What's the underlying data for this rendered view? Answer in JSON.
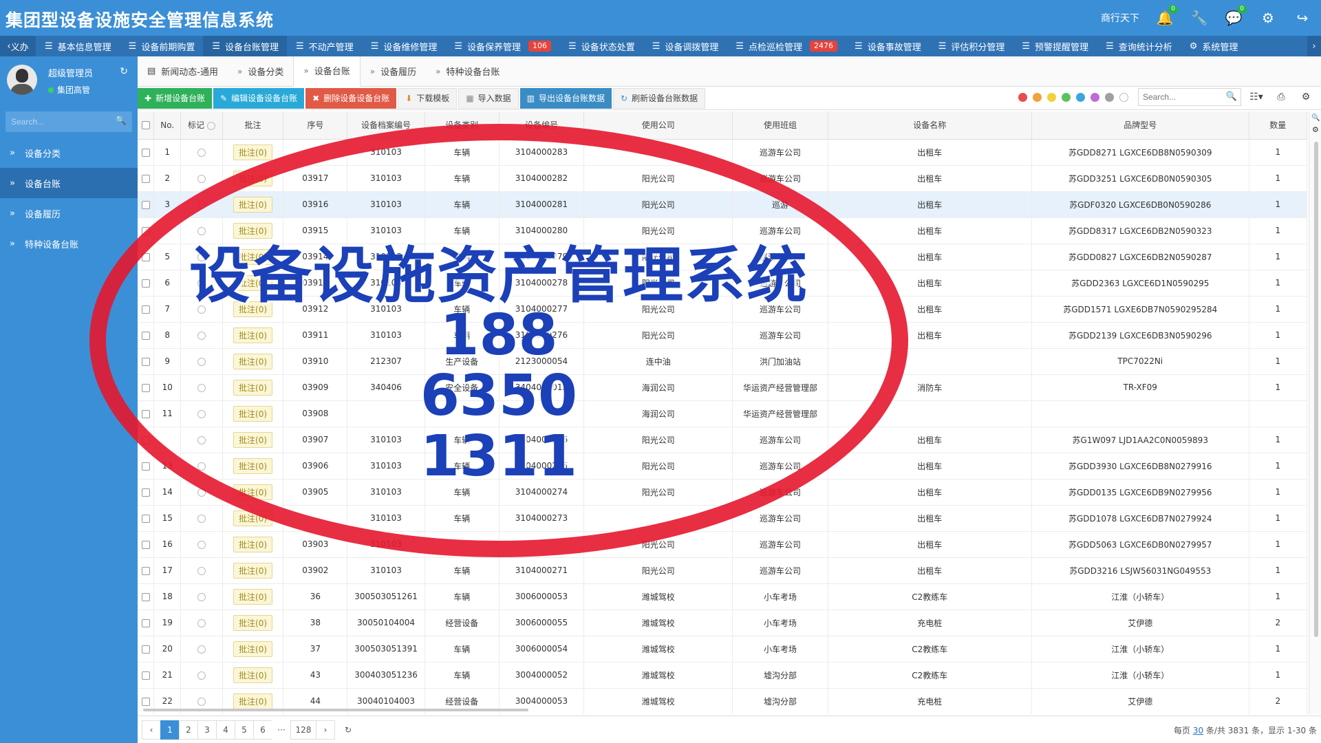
{
  "app": {
    "title": "集团型设备设施安全管理信息系统"
  },
  "header": {
    "user": "商行天下",
    "notif_badge": "0",
    "msg_badge": "0"
  },
  "menu": {
    "back_label": "义办",
    "items": [
      {
        "label": "基本信息管理"
      },
      {
        "label": "设备前期购置"
      },
      {
        "label": "设备台账管理"
      },
      {
        "label": "不动产管理"
      },
      {
        "label": "设备维修管理"
      },
      {
        "label": "设备保养管理",
        "badge": "106"
      },
      {
        "label": "设备状态处置"
      },
      {
        "label": "设备调拨管理"
      },
      {
        "label": "点检巡检管理",
        "badge": "2476"
      },
      {
        "label": "设备事故管理"
      },
      {
        "label": "评估积分管理"
      },
      {
        "label": "预警提醒管理"
      },
      {
        "label": "查询统计分析"
      },
      {
        "label": "系统管理"
      }
    ]
  },
  "sidebar": {
    "user_name": "超级管理员",
    "user_role": "集团高管",
    "search_placeholder": "Search...",
    "items": [
      {
        "label": "设备分类"
      },
      {
        "label": "设备台账"
      },
      {
        "label": "设备履历"
      },
      {
        "label": "特种设备台账"
      }
    ]
  },
  "tabs": [
    {
      "label": "新闻动态-通用"
    },
    {
      "label": "设备分类"
    },
    {
      "label": "设备台账"
    },
    {
      "label": "设备履历"
    },
    {
      "label": "特种设备台账"
    }
  ],
  "toolbar": {
    "add": "新增设备台账",
    "edit": "编辑设备设备台账",
    "delete": "删除设备设备台账",
    "download": "下载模板",
    "import": "导入数据",
    "export": "导出设备台账数据",
    "refresh": "刷新设备台账数据",
    "search_placeholder": "Search...",
    "color_dots": [
      "#e84c4c",
      "#f0a33a",
      "#f2d13c",
      "#5cc35c",
      "#3aa6e0",
      "#c06ad6",
      "#a0a0a0",
      "#ffffff"
    ]
  },
  "table": {
    "headers": [
      "No.",
      "标记",
      "批注",
      "序号",
      "设备档案编号",
      "设备类别",
      "设备编号",
      "使用公司",
      "使用班组",
      "设备名称",
      "品牌型号",
      "数量"
    ],
    "rows": [
      {
        "no": "1",
        "note": "批注(0)",
        "seq": "",
        "archive": "310103",
        "category": "车辆",
        "code": "3104000283",
        "company": "",
        "team": "巡游车公司",
        "name": "出租车",
        "brand": "苏GDD8271 LGXCE6DB8N0590309",
        "qty": "1"
      },
      {
        "no": "2",
        "note": "批注(0)",
        "seq": "03917",
        "archive": "310103",
        "category": "车辆",
        "code": "3104000282",
        "company": "阳光公司",
        "team": "巡游车公司",
        "name": "出租车",
        "brand": "苏GDD3251 LGXCE6DB0N0590305",
        "qty": "1"
      },
      {
        "no": "3",
        "note": "批注(0)",
        "seq": "03916",
        "archive": "310103",
        "category": "车辆",
        "code": "3104000281",
        "company": "阳光公司",
        "team": "巡游",
        "name": "出租车",
        "brand": "苏GDF0320 LGXCE6DB0N0590286",
        "qty": "1"
      },
      {
        "no": "",
        "note": "批注(0)",
        "seq": "03915",
        "archive": "310103",
        "category": "车辆",
        "code": "3104000280",
        "company": "阳光公司",
        "team": "巡游车公司",
        "name": "出租车",
        "brand": "苏GDD8317 LGXCE6DB2N0590323",
        "qty": "1"
      },
      {
        "no": "5",
        "note": "批注(0)",
        "seq": "03914",
        "archive": "310103",
        "category": "车辆",
        "code": "3104000279",
        "company": "阳光公司",
        "team": "巡游车公司",
        "name": "出租车",
        "brand": "苏GDD0827 LGXCE6DB2N0590287",
        "qty": "1"
      },
      {
        "no": "6",
        "note": "批注(0)",
        "seq": "03913",
        "archive": "310103",
        "category": "车辆",
        "code": "3104000278",
        "company": "阳光公司",
        "team": "巡游车公司",
        "name": "出租车",
        "brand": "苏GDD2363 LGXCE6D1N0590295",
        "qty": "1"
      },
      {
        "no": "7",
        "note": "批注(0)",
        "seq": "03912",
        "archive": "310103",
        "category": "车辆",
        "code": "3104000277",
        "company": "阳光公司",
        "team": "巡游车公司",
        "name": "出租车",
        "brand": "苏GDD1571 LGXE6DB7N0590295284",
        "qty": "1"
      },
      {
        "no": "8",
        "note": "批注(0)",
        "seq": "03911",
        "archive": "310103",
        "category": "车辆",
        "code": "3104000276",
        "company": "阳光公司",
        "team": "巡游车公司",
        "name": "出租车",
        "brand": "苏GDD2139 LGXCE6DB3N0590296",
        "qty": "1"
      },
      {
        "no": "9",
        "note": "批注(0)",
        "seq": "03910",
        "archive": "212307",
        "category": "生产设备",
        "code": "2123000054",
        "company": "连中油",
        "team": "洪门加油站",
        "name": "",
        "brand": "TPC7022Ni",
        "qty": "1"
      },
      {
        "no": "10",
        "note": "批注(0)",
        "seq": "03909",
        "archive": "340406",
        "category": "安全设备",
        "code": "3404000013",
        "company": "海润公司",
        "team": "华运资产经营管理部",
        "name": "消防车",
        "brand": "TR-XF09",
        "qty": "1"
      },
      {
        "no": "11",
        "note": "批注(0)",
        "seq": "03908",
        "archive": "",
        "category": "",
        "code": "",
        "company": "海润公司",
        "team": "华运资产经营管理部",
        "name": "",
        "brand": "",
        "qty": ""
      },
      {
        "no": "",
        "note": "批注(0)",
        "seq": "03907",
        "archive": "310103",
        "category": "车辆",
        "code": "3104000276",
        "company": "阳光公司",
        "team": "巡游车公司",
        "name": "出租车",
        "brand": "苏G1W097 LJD1AA2C0N0059893",
        "qty": "1"
      },
      {
        "no": "13",
        "note": "批注(0)",
        "seq": "03906",
        "archive": "310103",
        "category": "车辆",
        "code": "3104000275",
        "company": "阳光公司",
        "team": "巡游车公司",
        "name": "出租车",
        "brand": "苏GDD3930 LGXCE6DB8N0279916",
        "qty": "1"
      },
      {
        "no": "14",
        "note": "批注(0)",
        "seq": "03905",
        "archive": "310103",
        "category": "车辆",
        "code": "3104000274",
        "company": "阳光公司",
        "team": "巡游车公司",
        "name": "出租车",
        "brand": "苏GDD0135 LGXCE6DB9N0279956",
        "qty": "1"
      },
      {
        "no": "15",
        "note": "批注(0)",
        "seq": "",
        "archive": "310103",
        "category": "车辆",
        "code": "3104000273",
        "company": "",
        "team": "巡游车公司",
        "name": "出租车",
        "brand": "苏GDD1078 LGXCE6DB7N0279924",
        "qty": "1"
      },
      {
        "no": "16",
        "note": "批注(0)",
        "seq": "03903",
        "archive": "310103",
        "category": "",
        "code": "",
        "company": "阳光公司",
        "team": "巡游车公司",
        "name": "出租车",
        "brand": "苏GDD5063 LGXCE6DB0N0279957",
        "qty": "1"
      },
      {
        "no": "17",
        "note": "批注(0)",
        "seq": "03902",
        "archive": "310103",
        "category": "车辆",
        "code": "3104000271",
        "company": "阳光公司",
        "team": "巡游车公司",
        "name": "出租车",
        "brand": "苏GDD3216 LSJW56031NG049553",
        "qty": "1"
      },
      {
        "no": "18",
        "note": "批注(0)",
        "seq": "36",
        "archive": "300503051261",
        "category": "车辆",
        "code": "3006000053",
        "company": "潍城驾校",
        "team": "小车考场",
        "name": "C2教练车",
        "brand": "江淮（小轿车）",
        "qty": "1"
      },
      {
        "no": "19",
        "note": "批注(0)",
        "seq": "38",
        "archive": "30050104004",
        "category": "经营设备",
        "code": "3006000055",
        "company": "潍城驾校",
        "team": "小车考场",
        "name": "充电桩",
        "brand": "艾伊德",
        "qty": "2"
      },
      {
        "no": "20",
        "note": "批注(0)",
        "seq": "37",
        "archive": "300503051391",
        "category": "车辆",
        "code": "3006000054",
        "company": "潍城驾校",
        "team": "小车考场",
        "name": "C2教练车",
        "brand": "江淮（小轿车）",
        "qty": "1"
      },
      {
        "no": "21",
        "note": "批注(0)",
        "seq": "43",
        "archive": "300403051236",
        "category": "车辆",
        "code": "3004000052",
        "company": "潍城驾校",
        "team": "墟沟分部",
        "name": "C2教练车",
        "brand": "江淮（小轿车）",
        "qty": "1"
      },
      {
        "no": "22",
        "note": "批注(0)",
        "seq": "44",
        "archive": "30040104003",
        "category": "经营设备",
        "code": "3004000053",
        "company": "潍城驾校",
        "team": "墟沟分部",
        "name": "充电桩",
        "brand": "艾伊德",
        "qty": "2"
      }
    ]
  },
  "pager": {
    "pages": [
      "1",
      "2",
      "3",
      "4",
      "5",
      "6"
    ],
    "ellipsis": "···",
    "last": "128",
    "info_prefix": "每页",
    "page_size": "30",
    "info_suffix": "条/共 3831 条，显示 1-30 条"
  },
  "overlay": {
    "title": "设备设施资产管理系统",
    "numbers": [
      "188",
      "6350",
      "1311"
    ],
    "ring_color": "#e5172f",
    "text_color": "#1b40b8"
  }
}
